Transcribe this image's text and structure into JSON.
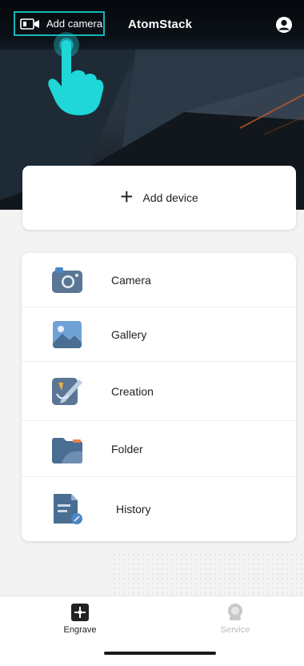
{
  "header": {
    "add_camera_label": "Add camera",
    "app_title": "AtomStack",
    "profile_icon": "user-icon"
  },
  "add_device": {
    "label": "Add device",
    "icon": "plus-icon"
  },
  "menu": {
    "items": [
      {
        "label": "Camera",
        "icon": "camera-icon"
      },
      {
        "label": "Gallery",
        "icon": "gallery-icon"
      },
      {
        "label": "Creation",
        "icon": "creation-icon"
      },
      {
        "label": "Folder",
        "icon": "folder-icon"
      },
      {
        "label": "History",
        "icon": "history-icon"
      }
    ]
  },
  "bottom_nav": {
    "tabs": [
      {
        "label": "Engrave",
        "icon": "engrave-icon",
        "active": true
      },
      {
        "label": "Service",
        "icon": "service-icon",
        "active": false
      }
    ]
  },
  "colors": {
    "accent": "#16b6b8",
    "tap_indicator": "#1fd6d8",
    "text_primary": "#222222",
    "text_inactive": "#bdbdbd"
  }
}
